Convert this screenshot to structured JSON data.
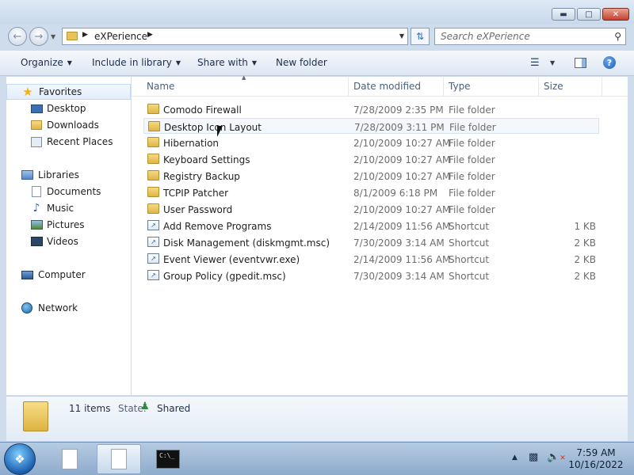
{
  "window": {
    "controls": {
      "minimize": "▬",
      "maximize": "□",
      "close": "✕"
    }
  },
  "address": {
    "crumb": "eXPerience",
    "search_placeholder": "Search eXPerience"
  },
  "toolbar": {
    "organize": "Organize",
    "include_in_library": "Include in library",
    "share_with": "Share with",
    "new_folder": "New folder"
  },
  "nav": {
    "favorites": {
      "label": "Favorites",
      "items": [
        {
          "label": "Desktop",
          "icon": "desktop-icon"
        },
        {
          "label": "Downloads",
          "icon": "downloads-icon"
        },
        {
          "label": "Recent Places",
          "icon": "recent-places-icon"
        }
      ]
    },
    "libraries": {
      "label": "Libraries",
      "items": [
        {
          "label": "Documents",
          "icon": "documents-icon"
        },
        {
          "label": "Music",
          "icon": "music-icon"
        },
        {
          "label": "Pictures",
          "icon": "pictures-icon"
        },
        {
          "label": "Videos",
          "icon": "videos-icon"
        }
      ]
    },
    "computer": "Computer",
    "network": "Network"
  },
  "columns": {
    "name": "Name",
    "date_modified": "Date modified",
    "type": "Type",
    "size": "Size"
  },
  "files": [
    {
      "name": "Comodo Firewall",
      "date": "7/28/2009 2:35 PM",
      "type": "File folder",
      "size": "",
      "kind": "folder"
    },
    {
      "name": "Desktop Icon Layout",
      "date": "7/28/2009 3:11 PM",
      "type": "File folder",
      "size": "",
      "kind": "folder"
    },
    {
      "name": "Hibernation",
      "date": "2/10/2009 10:27 AM",
      "type": "File folder",
      "size": "",
      "kind": "folder"
    },
    {
      "name": "Keyboard Settings",
      "date": "2/10/2009 10:27 AM",
      "type": "File folder",
      "size": "",
      "kind": "folder"
    },
    {
      "name": "Registry Backup",
      "date": "2/10/2009 10:27 AM",
      "type": "File folder",
      "size": "",
      "kind": "folder"
    },
    {
      "name": "TCPIP Patcher",
      "date": "8/1/2009 6:18 PM",
      "type": "File folder",
      "size": "",
      "kind": "folder"
    },
    {
      "name": "User Password",
      "date": "2/10/2009 10:27 AM",
      "type": "File folder",
      "size": "",
      "kind": "folder"
    },
    {
      "name": "Add Remove Programs",
      "date": "2/14/2009 11:56 AM",
      "type": "Shortcut",
      "size": "1 KB",
      "kind": "shortcut"
    },
    {
      "name": "Disk Management (diskmgmt.msc)",
      "date": "7/30/2009 3:14 AM",
      "type": "Shortcut",
      "size": "2 KB",
      "kind": "shortcut"
    },
    {
      "name": "Event Viewer (eventvwr.exe)",
      "date": "2/14/2009 11:56 AM",
      "type": "Shortcut",
      "size": "2 KB",
      "kind": "shortcut"
    },
    {
      "name": "Group Policy (gpedit.msc)",
      "date": "7/30/2009 3:14 AM",
      "type": "Shortcut",
      "size": "2 KB",
      "kind": "shortcut"
    }
  ],
  "details": {
    "count": "11 items",
    "state_label": "State:",
    "state_value": "Shared"
  },
  "taskbar": {
    "cmd_text": "C:\\_",
    "time": "7:59 AM",
    "date": "10/16/2022"
  }
}
